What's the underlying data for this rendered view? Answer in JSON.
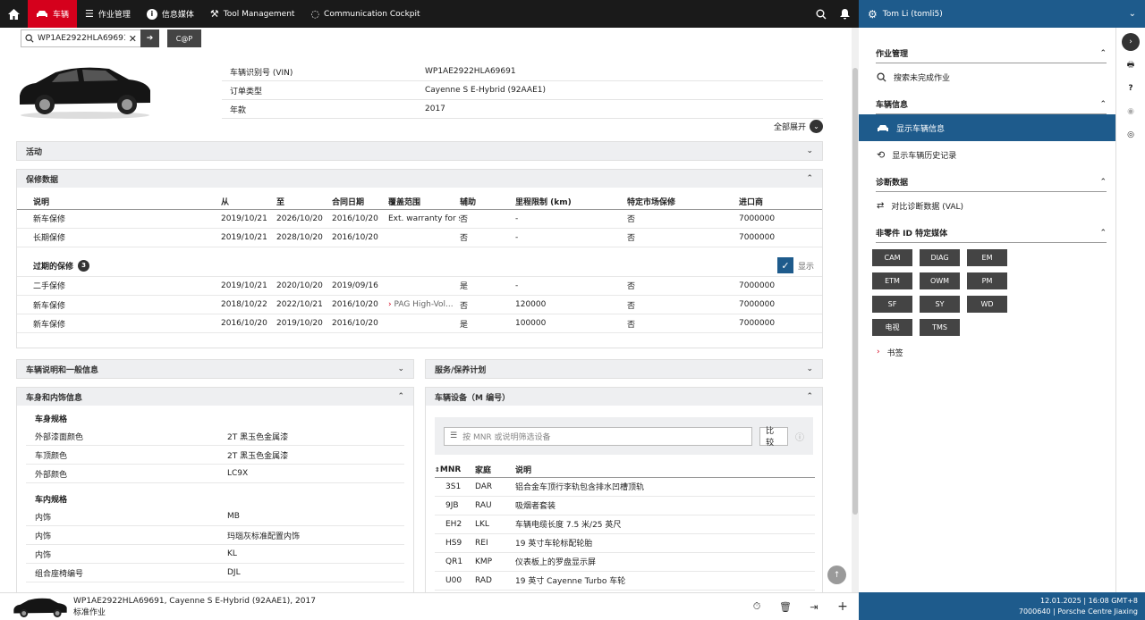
{
  "nav": {
    "vehicle": "车辆",
    "work": "作业管理",
    "info": "信息媒体",
    "tool": "Tool Management",
    "comm": "Communication Cockpit"
  },
  "user": {
    "name": "Tom Li (tomli5)"
  },
  "search": {
    "value": "WP1AE2922HLA69691",
    "co_label": "C@P"
  },
  "vehicle": {
    "rows": [
      {
        "k": "车辆识别号 (VIN)",
        "v": "WP1AE2922HLA69691"
      },
      {
        "k": "订单类型",
        "v": "Cayenne S E-Hybrid (92AAE1)"
      },
      {
        "k": "年款",
        "v": "2017"
      }
    ],
    "expand_all": "全部展开"
  },
  "panels": {
    "activity": "活动",
    "warranty": "保修数据",
    "desc": "车辆说明和一般信息",
    "service": "服务/保养计划",
    "body": "车身和内饰信息",
    "equip": "车辆设备（M 编号）"
  },
  "warranty": {
    "headers": [
      "说明",
      "从",
      "至",
      "合同日期",
      "覆盖范围",
      "辅助",
      "里程限制 (km)",
      "特定市场保修",
      "进口商"
    ],
    "rows": [
      [
        "新车保修",
        "2019/10/21",
        "2026/10/20",
        "2016/10/20",
        "Ext. warranty for s...",
        "否",
        "-",
        "否",
        "7000000"
      ],
      [
        "长期保修",
        "2019/10/21",
        "2028/10/20",
        "2016/10/20",
        "",
        "否",
        "-",
        "否",
        "7000000"
      ]
    ],
    "expired_label": "过期的保修",
    "expired_count": "3",
    "show_label": "显示",
    "expired": [
      [
        "二手保修",
        "2019/10/21",
        "2020/10/20",
        "2019/09/16",
        "",
        "是",
        "-",
        "否",
        "7000000"
      ],
      [
        "新车保修",
        "2018/10/22",
        "2022/10/21",
        "2016/10/20",
        "PAG High-Vol...",
        "否",
        "120000",
        "否",
        "7000000"
      ],
      [
        "新车保修",
        "2016/10/20",
        "2019/10/20",
        "2016/10/20",
        "",
        "是",
        "100000",
        "否",
        "7000000"
      ]
    ]
  },
  "body": {
    "exterior_title": "车身规格",
    "exterior": [
      {
        "k": "外部漆面颜色",
        "v": "2T 黑玉色金属漆"
      },
      {
        "k": "车顶颜色",
        "v": "2T 黑玉色金属漆"
      },
      {
        "k": "外部颜色",
        "v": "LC9X"
      }
    ],
    "interior_title": "车内规格",
    "interior": [
      {
        "k": "内饰",
        "v": "MB"
      },
      {
        "k": "内饰",
        "v": "玛瑙灰标准配置内饰"
      },
      {
        "k": "内饰",
        "v": "KL"
      },
      {
        "k": "组合座椅编号",
        "v": "DJL"
      }
    ]
  },
  "equip": {
    "placeholder": "按 MNR 或说明筛选设备",
    "compare": "比较",
    "headers": [
      "MNR",
      "家庭",
      "说明"
    ],
    "rows": [
      [
        "3S1",
        "DAR",
        "铝合金车顶行李轨包含排水凹槽顶轨"
      ],
      [
        "9JB",
        "RAU",
        "吸烟者套装"
      ],
      [
        "EH2",
        "LKL",
        "车辆电缆长度 7.5 米/25 英尺"
      ],
      [
        "HS9",
        "REI",
        "19 英寸车轮标配轮胎"
      ],
      [
        "QR1",
        "KMP",
        "仪表板上的罗盘显示屏"
      ],
      [
        "U00",
        "RAD",
        "19 英寸 Cayenne Turbo 车轮"
      ]
    ]
  },
  "bottom": {
    "line1": "WP1AE2922HLA69691, Cayenne S E-Hybrid (92AAE1), 2017",
    "line2": "标准作业"
  },
  "side": {
    "work_title": "作业管理",
    "search_open": "搜索未完成作业",
    "vinfo_title": "车辆信息",
    "show_vinfo": "显示车辆信息",
    "show_history": "显示车辆历史记录",
    "diag_title": "诊断数据",
    "compare_diag": "对比诊断数据 (VAL)",
    "media_title": "非零件 ID 特定媒体",
    "media": [
      "CAM",
      "DIAG",
      "EM",
      "ETM",
      "OWM",
      "PM",
      "SF",
      "SY",
      "WD",
      "电视",
      "TMS"
    ],
    "bookmarks": "书签"
  },
  "status": {
    "line1": "12.01.2025 | 16:08 GMT+8",
    "line2": "7000640 | Porsche Centre Jiaxing"
  }
}
